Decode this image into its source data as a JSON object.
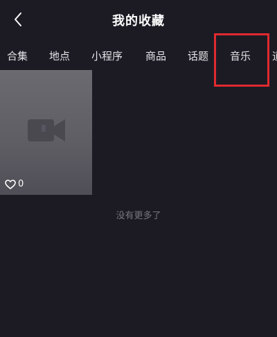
{
  "header": {
    "title": "我的收藏",
    "back_icon": "chevron-left-icon"
  },
  "tabs": [
    {
      "label": "合集"
    },
    {
      "label": "地点"
    },
    {
      "label": "小程序"
    },
    {
      "label": "商品"
    },
    {
      "label": "话题"
    },
    {
      "label": "音乐"
    },
    {
      "label": "道"
    }
  ],
  "highlight": {
    "color": "#e02a2f",
    "target": "音乐"
  },
  "grid": {
    "items": [
      {
        "likes": "0",
        "thumb_icon": "video-camera-icon",
        "like_icon": "heart-icon"
      }
    ]
  },
  "empty_note": "没有更多了",
  "colors": {
    "background": "#1c1b24",
    "card": "#5e5d64",
    "muted_text": "#77767e"
  }
}
